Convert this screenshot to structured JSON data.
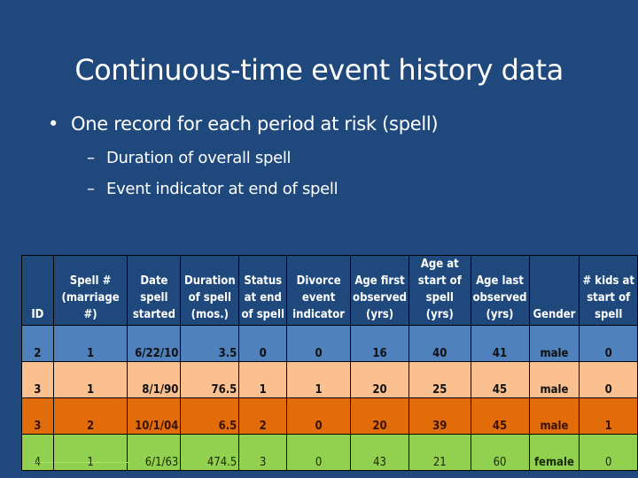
{
  "slide": {
    "title": "Continuous-time event history data",
    "bullet": "One record for each period at risk (spell)",
    "bullet_marker": "•",
    "sub_marker": "–",
    "sub_bullets": [
      "Duration of overall spell",
      "Event indicator at end of spell"
    ]
  },
  "table": {
    "headers": [
      [
        "ID"
      ],
      [
        "Spell #",
        "(marriage #)"
      ],
      [
        "Date",
        "spell",
        "started"
      ],
      [
        "Duration",
        "of spell",
        "(mos.)"
      ],
      [
        "Status",
        "at end",
        "of spell"
      ],
      [
        "Divorce",
        "event",
        "indicator"
      ],
      [
        "Age first",
        "observed",
        "(yrs)"
      ],
      [
        "Age at",
        "start of",
        "spell (yrs)"
      ],
      [
        "Age last",
        "observed",
        "(yrs)"
      ],
      [
        "Gender"
      ],
      [
        "# kids at",
        "start of",
        "spell"
      ]
    ],
    "rows": [
      [
        "2",
        "1",
        "6/22/10",
        "3.5",
        "0",
        "0",
        "16",
        "40",
        "41",
        "male",
        "0"
      ],
      [
        "3",
        "1",
        "8/1/90",
        "76.5",
        "1",
        "1",
        "20",
        "25",
        "45",
        "male",
        "0"
      ],
      [
        "3",
        "2",
        "10/1/04",
        "6.5",
        "2",
        "0",
        "20",
        "39",
        "45",
        "male",
        "1"
      ],
      [
        "4",
        "1",
        "6/1/63",
        "474.5",
        "3",
        "0",
        "43",
        "21",
        "60",
        "female",
        "0"
      ]
    ],
    "row_colors": [
      "#4f81bd",
      "#fac090",
      "#e36c0a",
      "#92d050"
    ],
    "header_color": "#1f497d"
  }
}
